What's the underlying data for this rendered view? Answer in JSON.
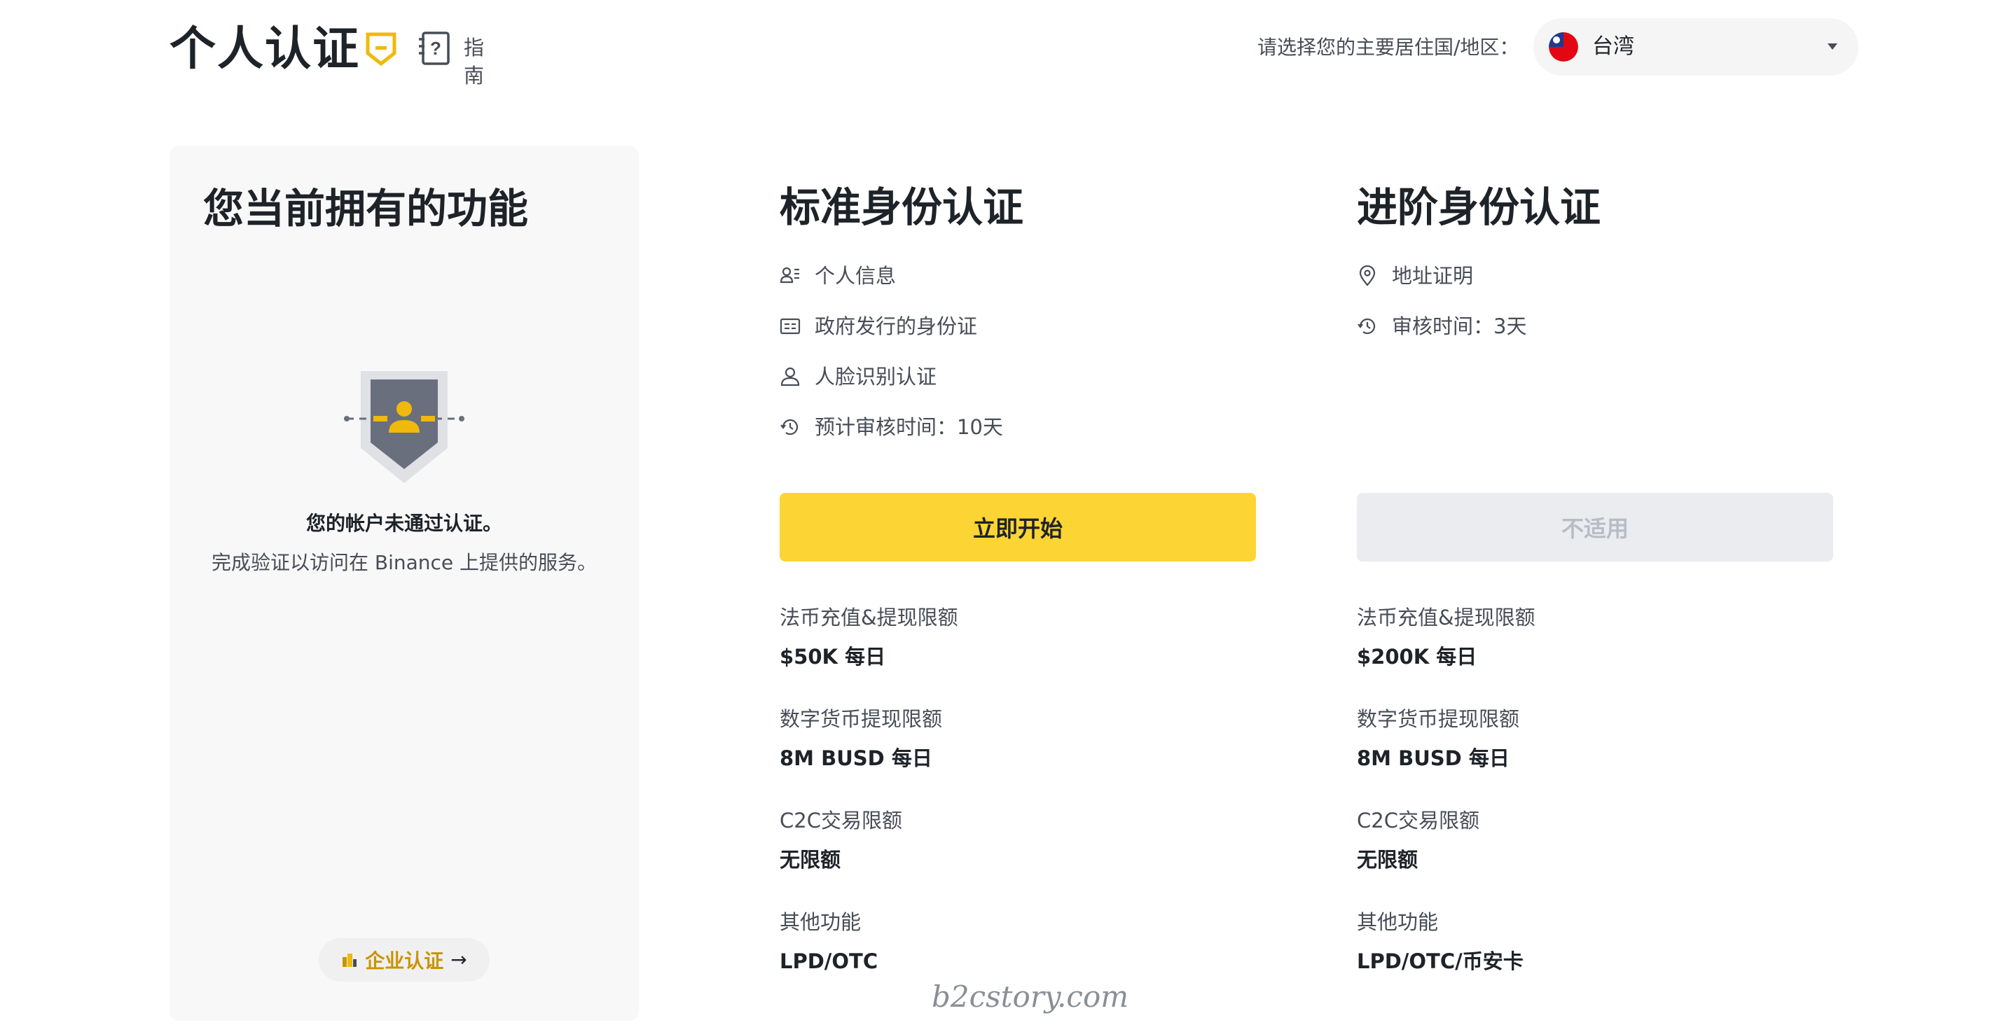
{
  "header": {
    "title": "个人认证",
    "guide_label": "指南",
    "country_label": "请选择您的主要居住国/地区：",
    "country_value": "台湾"
  },
  "current_panel": {
    "title": "您当前拥有的功能",
    "status_text": "您的帐户未通过认证。",
    "description": "完成验证以访问在 Binance 上提供的服务。",
    "enterprise_label": "企业认证"
  },
  "tiers": [
    {
      "title": "标准身份认证",
      "requirements": [
        {
          "icon": "person-info-icon",
          "label": "个人信息"
        },
        {
          "icon": "id-card-icon",
          "label": "政府发行的身份证"
        },
        {
          "icon": "face-icon",
          "label": "人脸识别认证"
        },
        {
          "icon": "clock-icon",
          "label": "预计审核时间：10天"
        }
      ],
      "button_label": "立即开始",
      "limits": [
        {
          "label": "法币充值&提现限额",
          "value": "$50K 每日"
        },
        {
          "label": "数字货币提现限额",
          "value": "8M BUSD 每日"
        },
        {
          "label": "C2C交易限额",
          "value": "无限额"
        },
        {
          "label": "其他功能",
          "value": "LPD/OTC"
        }
      ]
    },
    {
      "title": "进阶身份认证",
      "requirements": [
        {
          "icon": "location-icon",
          "label": "地址证明"
        },
        {
          "icon": "clock-icon",
          "label": "审核时间：3天"
        }
      ],
      "button_label": "不适用",
      "limits": [
        {
          "label": "法币充值&提现限额",
          "value": "$200K 每日"
        },
        {
          "label": "数字货币提现限额",
          "value": "8M BUSD 每日"
        },
        {
          "label": "C2C交易限额",
          "value": "无限额"
        },
        {
          "label": "其他功能",
          "value": "LPD/OTC/币安卡"
        }
      ]
    }
  ],
  "watermark": "b2cstory.com",
  "colors": {
    "accent_yellow": "#fcd535",
    "link_gold": "#c99400",
    "disabled_bg": "#eaecef",
    "panel_bg": "#f8f8f8"
  }
}
